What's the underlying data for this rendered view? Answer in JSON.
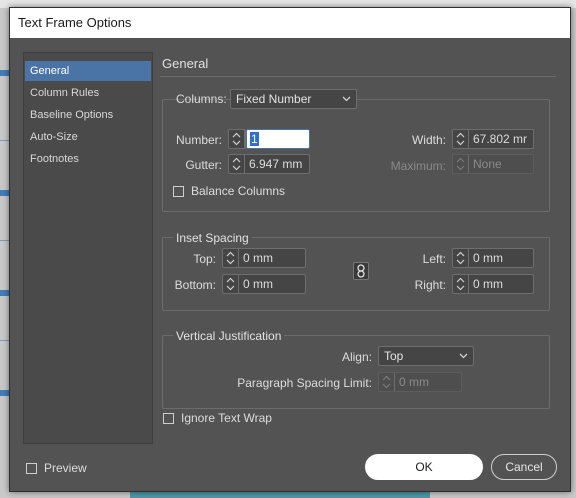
{
  "window": {
    "title": "Text Frame Options"
  },
  "sidebar": {
    "items": [
      {
        "label": "General",
        "selected": true
      },
      {
        "label": "Column Rules"
      },
      {
        "label": "Baseline Options"
      },
      {
        "label": "Auto-Size"
      },
      {
        "label": "Footnotes"
      }
    ]
  },
  "general": {
    "title": "General",
    "columns": {
      "label": "Columns:",
      "type_value": "Fixed Number",
      "number_label": "Number:",
      "number_value": "1",
      "width_label": "Width:",
      "width_value": "67.802 mr",
      "gutter_label": "Gutter:",
      "gutter_value": "6.947 mm",
      "maximum_label": "Maximum:",
      "maximum_value": "None",
      "balance_label": "Balance Columns",
      "balance_checked": false
    },
    "inset": {
      "title": "Inset Spacing",
      "top_label": "Top:",
      "top_value": "0 mm",
      "bottom_label": "Bottom:",
      "bottom_value": "0 mm",
      "left_label": "Left:",
      "left_value": "0 mm",
      "right_label": "Right:",
      "right_value": "0 mm"
    },
    "vertical": {
      "title": "Vertical Justification",
      "align_label": "Align:",
      "align_value": "Top",
      "spacing_label": "Paragraph Spacing Limit:",
      "spacing_value": "0 mm"
    },
    "ignore_wrap_label": "Ignore Text Wrap",
    "ignore_wrap_checked": false
  },
  "footer": {
    "preview_label": "Preview",
    "preview_checked": false,
    "ok_label": "OK",
    "cancel_label": "Cancel"
  },
  "colors": {
    "dialog_bg": "#535353",
    "selection": "#4b74a6",
    "accent_input": "#2d6fd6"
  }
}
